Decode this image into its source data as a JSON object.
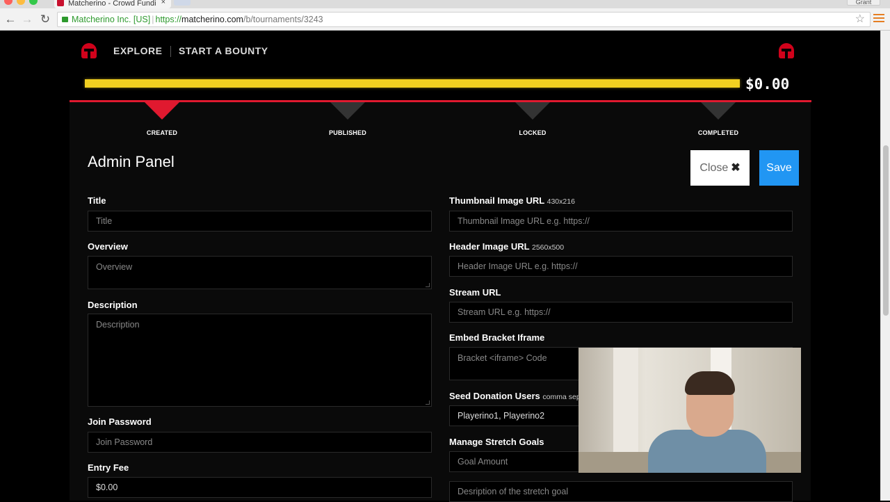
{
  "browser": {
    "tab_title": "Matcherino - Crowd Fundi",
    "tab_close": "×",
    "profile": "Grant",
    "back": "←",
    "forward": "→",
    "reload": "↻",
    "ev_label": "Matcherino Inc. [US]",
    "url_scheme": "https://",
    "url_host": "matcherino.com",
    "url_path": "/b/tournaments/3243",
    "star": "☆"
  },
  "header": {
    "nav": [
      "EXPLORE",
      "START A BOUNTY"
    ],
    "amount": "$0.00"
  },
  "steps": [
    "CREATED",
    "PUBLISHED",
    "LOCKED",
    "COMPLETED"
  ],
  "panel": {
    "title": "Admin Panel",
    "close_label": "Close",
    "close_icon": "✖",
    "save_label": "Save"
  },
  "left_form": {
    "title_label": "Title",
    "title_placeholder": "Title",
    "overview_label": "Overview",
    "overview_placeholder": "Overview",
    "description_label": "Description",
    "description_placeholder": "Description",
    "join_password_label": "Join Password",
    "join_password_placeholder": "Join Password",
    "entry_fee_label": "Entry Fee",
    "entry_fee_value": "$0.00"
  },
  "right_form": {
    "thumbnail_label": "Thumbnail Image URL",
    "thumbnail_sub": "430x216",
    "thumbnail_placeholder": "Thumbnail Image URL e.g. https://",
    "header_label": "Header Image URL",
    "header_sub": "2560x500",
    "header_placeholder": "Header Image URL e.g. https://",
    "stream_label": "Stream URL",
    "stream_placeholder": "Stream URL e.g. https://",
    "embed_label": "Embed Bracket Iframe",
    "embed_placeholder": "Bracket <iframe> Code",
    "seed_label": "Seed Donation Users",
    "seed_sub": "comma sepa",
    "seed_value": "Playerino1, Playerino2",
    "stretch_label": "Manage Stretch Goals",
    "goal_amount_placeholder": "Goal Amount",
    "goal_desc_placeholder": "Desription of the stretch goal"
  },
  "colors": {
    "accent_red": "#e0192f",
    "progress_yellow": "#f2d021",
    "save_blue": "#2196f3"
  },
  "progress": {
    "funded_fraction": 0
  }
}
